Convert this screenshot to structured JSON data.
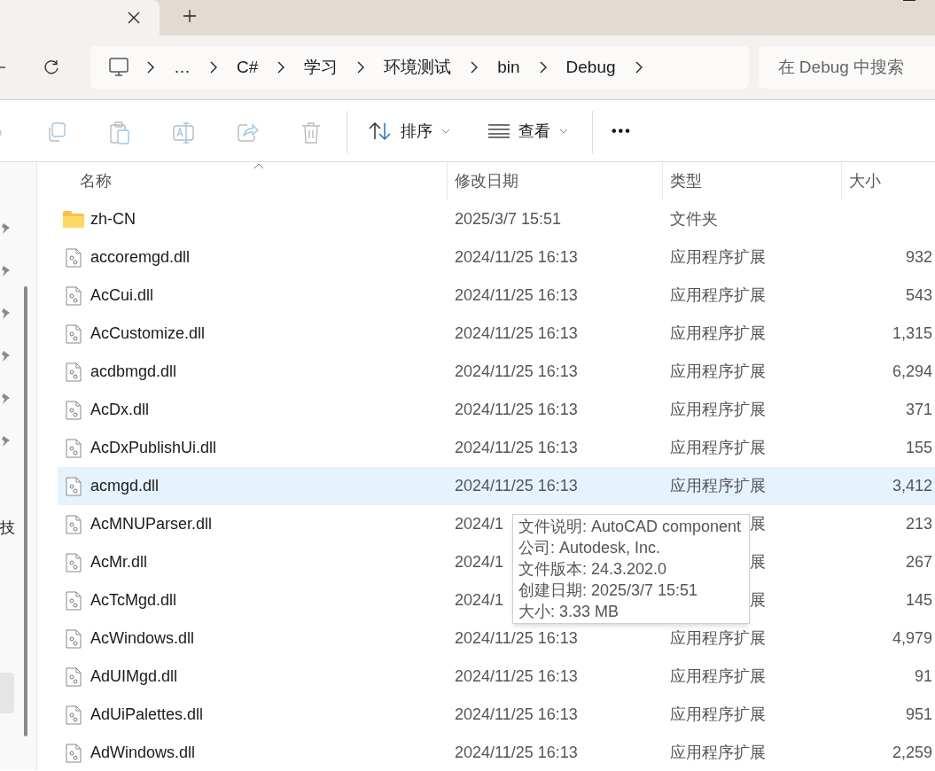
{
  "tabs": [
    {
      "selected": true
    }
  ],
  "breadcrumb": [
    "…",
    "C#",
    "学习",
    "环境测试",
    "bin",
    "Debug"
  ],
  "search": {
    "placeholder": "在 Debug 中搜索"
  },
  "toolbar": {
    "sort": "排序",
    "view": "查看",
    "more": "•••"
  },
  "nav_pane": {
    "partial_text": "技"
  },
  "columns": [
    "名称",
    "修改日期",
    "类型",
    "大小"
  ],
  "rows": [
    {
      "kind": "folder",
      "name": "zh-CN",
      "date": "2025/3/7 15:51",
      "type": "文件夹",
      "size": "",
      "selected": false
    },
    {
      "kind": "dll",
      "name": "accoremgd.dll",
      "date": "2024/11/25 16:13",
      "type": "应用程序扩展",
      "size": "932",
      "selected": false
    },
    {
      "kind": "dll",
      "name": "AcCui.dll",
      "date": "2024/11/25 16:13",
      "type": "应用程序扩展",
      "size": "543",
      "selected": false
    },
    {
      "kind": "dll",
      "name": "AcCustomize.dll",
      "date": "2024/11/25 16:13",
      "type": "应用程序扩展",
      "size": "1,315",
      "selected": false
    },
    {
      "kind": "dll",
      "name": "acdbmgd.dll",
      "date": "2024/11/25 16:13",
      "type": "应用程序扩展",
      "size": "6,294",
      "selected": false
    },
    {
      "kind": "dll",
      "name": "AcDx.dll",
      "date": "2024/11/25 16:13",
      "type": "应用程序扩展",
      "size": "371",
      "selected": false
    },
    {
      "kind": "dll",
      "name": "AcDxPublishUi.dll",
      "date": "2024/11/25 16:13",
      "type": "应用程序扩展",
      "size": "155",
      "selected": false
    },
    {
      "kind": "dll",
      "name": "acmgd.dll",
      "date": "2024/11/25 16:13",
      "type": "应用程序扩展",
      "size": "3,412",
      "selected": true
    },
    {
      "kind": "dll",
      "name": "AcMNUParser.dll",
      "date": "2024/1",
      "type": "展",
      "size": "213",
      "selected": false,
      "covered": true
    },
    {
      "kind": "dll",
      "name": "AcMr.dll",
      "date": "2024/1",
      "type": "展",
      "size": "267",
      "selected": false,
      "covered": true
    },
    {
      "kind": "dll",
      "name": "AcTcMgd.dll",
      "date": "2024/1",
      "type": "展",
      "size": "145",
      "selected": false,
      "covered": true
    },
    {
      "kind": "dll",
      "name": "AcWindows.dll",
      "date": "2024/11/25 16:13",
      "type": "应用程序扩展",
      "size": "4,979",
      "selected": false
    },
    {
      "kind": "dll",
      "name": "AdUIMgd.dll",
      "date": "2024/11/25 16:13",
      "type": "应用程序扩展",
      "size": "91",
      "selected": false
    },
    {
      "kind": "dll",
      "name": "AdUiPalettes.dll",
      "date": "2024/11/25 16:13",
      "type": "应用程序扩展",
      "size": "951",
      "selected": false
    },
    {
      "kind": "dll",
      "name": "AdWindows.dll",
      "date": "2024/11/25 16:13",
      "type": "应用程序扩展",
      "size": "2,259",
      "selected": false
    }
  ],
  "tooltip": [
    "文件说明: AutoCAD component",
    "公司: Autodesk, Inc.",
    "文件版本: 24.3.202.0",
    "创建日期: 2025/3/7 15:51",
    "大小: 3.33 MB"
  ]
}
